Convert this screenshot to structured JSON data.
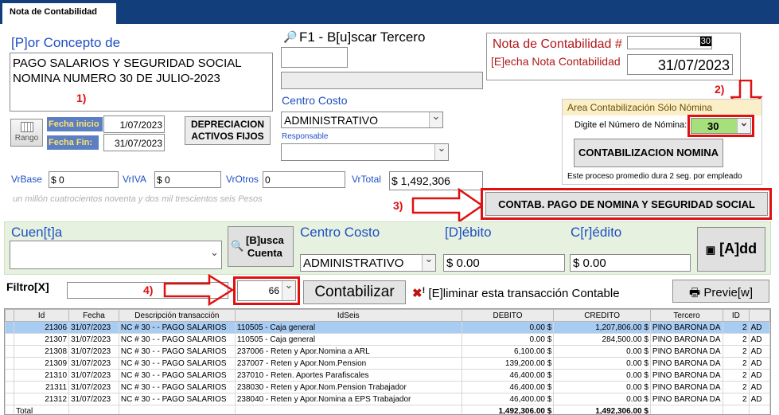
{
  "window": {
    "tab_title": "Nota de Contabilidad"
  },
  "concepto": {
    "label": "[P]or Concepto de",
    "text": "PAGO SALARIOS Y SEGURIDAD SOCIAL\nNOMINA NUMERO 30 DE JULIO-2023",
    "annotation": "1)"
  },
  "rango": {
    "button": "Rango",
    "fecha_inicio_label": "Fecha inicio",
    "fecha_inicio": "1/07/2023",
    "fecha_fin_label": "Fecha Fin:",
    "fecha_fin": "31/07/2023"
  },
  "depreciacion_button": "DEPRECIACION\nACTIVOS FIJOS",
  "tercero": {
    "label": "F1 - B[u]scar Tercero",
    "code": "",
    "name": ""
  },
  "centro_costo": {
    "label": "Centro Costo",
    "value": "ADMINISTRATIVO",
    "responsable_label": "Responsable",
    "responsable": ""
  },
  "nota": {
    "label": "Nota de Contabilidad #",
    "number": "30",
    "fecha_label": "[E]echa Nota Contabilidad",
    "fecha": "31/07/2023"
  },
  "nomina": {
    "annotation": "2)",
    "title": "Area Contabilización Sólo Nómina",
    "digite_label": "Digite el Número de Nómina:",
    "number": "30",
    "button": "CONTABILIZACION NOMINA",
    "note": "Este proceso promedio dura 2 seg. por empleado"
  },
  "valores": {
    "base_label": "VrBase",
    "base": "$ 0",
    "iva_label": "VrIVA",
    "iva": "$ 0",
    "otros_label": "VrOtros",
    "otros": "0",
    "total_label": "VrTotal",
    "total": "$ 1,492,306",
    "words": "un millón cuatrocientos noventa y dos mil trescientos seis Pesos"
  },
  "pago": {
    "annotation": "3)",
    "button": "CONTAB. PAGO DE NOMINA Y SEGURIDAD SOCIAL"
  },
  "entrada": {
    "cuenta_label": "Cuen[t]a",
    "busca_button": "[B]usca\nCuenta",
    "cc_label": "Centro Costo",
    "cc_value": "ADMINISTRATIVO",
    "debito_label": "[D]ébito",
    "debito": "$ 0.00",
    "credito_label": "C[r]édito",
    "credito": "$ 0.00",
    "add_button": "[A]dd"
  },
  "filtro": {
    "label": "Filtro[X]",
    "value": "",
    "annotation": "4)",
    "combo": "66",
    "contabilizar": "Contabilizar",
    "eliminar": "[E]liminar esta transacción Contable",
    "preview": "Previe[w]"
  },
  "grid": {
    "headers": [
      "Id",
      "Fecha",
      "Descripción transacción",
      "IdSeis",
      "DEBITO",
      "CREDITO",
      "Tercero",
      "ID",
      ""
    ],
    "rows": [
      [
        "21306",
        "31/07/2023",
        "NC # 30 -  - PAGO SALARIOS",
        "110505 - Caja general",
        "0.00 $",
        "1,207,806.00 $",
        "PINO BARONA DA",
        "2",
        "AD"
      ],
      [
        "21307",
        "31/07/2023",
        "NC # 30 -  - PAGO SALARIOS",
        "110505 - Caja general",
        "0.00 $",
        "284,500.00 $",
        "PINO BARONA DA",
        "2",
        "AD"
      ],
      [
        "21308",
        "31/07/2023",
        "NC # 30 -  - PAGO SALARIOS",
        "237006 - Reten y Apor.Nomina a ARL",
        "6,100.00 $",
        "0.00 $",
        "PINO BARONA DA",
        "2",
        "AD"
      ],
      [
        "21309",
        "31/07/2023",
        "NC # 30 -  - PAGO SALARIOS",
        "237007 - Reten y Apor.Nom.Pension",
        "139,200.00 $",
        "0.00 $",
        "PINO BARONA DA",
        "2",
        "AD"
      ],
      [
        "21310",
        "31/07/2023",
        "NC # 30 -  - PAGO SALARIOS",
        "237010 - Reten. Aportes Parafiscales",
        "46,400.00 $",
        "0.00 $",
        "PINO BARONA DA",
        "2",
        "AD"
      ],
      [
        "21311",
        "31/07/2023",
        "NC # 30 -  - PAGO SALARIOS",
        "238030 - Reten y Apor.Nom.Pension Trabajador",
        "46,400.00 $",
        "0.00 $",
        "PINO BARONA DA",
        "2",
        "AD"
      ],
      [
        "21312",
        "31/07/2023",
        "NC # 30 -  - PAGO SALARIOS",
        "238040 - Reten y Apor.Nomina a EPS Trabajador",
        "46,400.00 $",
        "0.00 $",
        "PINO BARONA DA",
        "2",
        "AD"
      ]
    ],
    "total_label": "Total",
    "total_debito": "1,492,306.00 $",
    "total_credito": "1,492,306.00 $"
  },
  "colors": {
    "title_bar": "#123f7c",
    "label_blue": "#1f4fc4",
    "label_red": "#b01818",
    "arrow_red": "#e01010",
    "panel_green": "#e6f2df",
    "nomina_combo": "#a6e07a"
  }
}
